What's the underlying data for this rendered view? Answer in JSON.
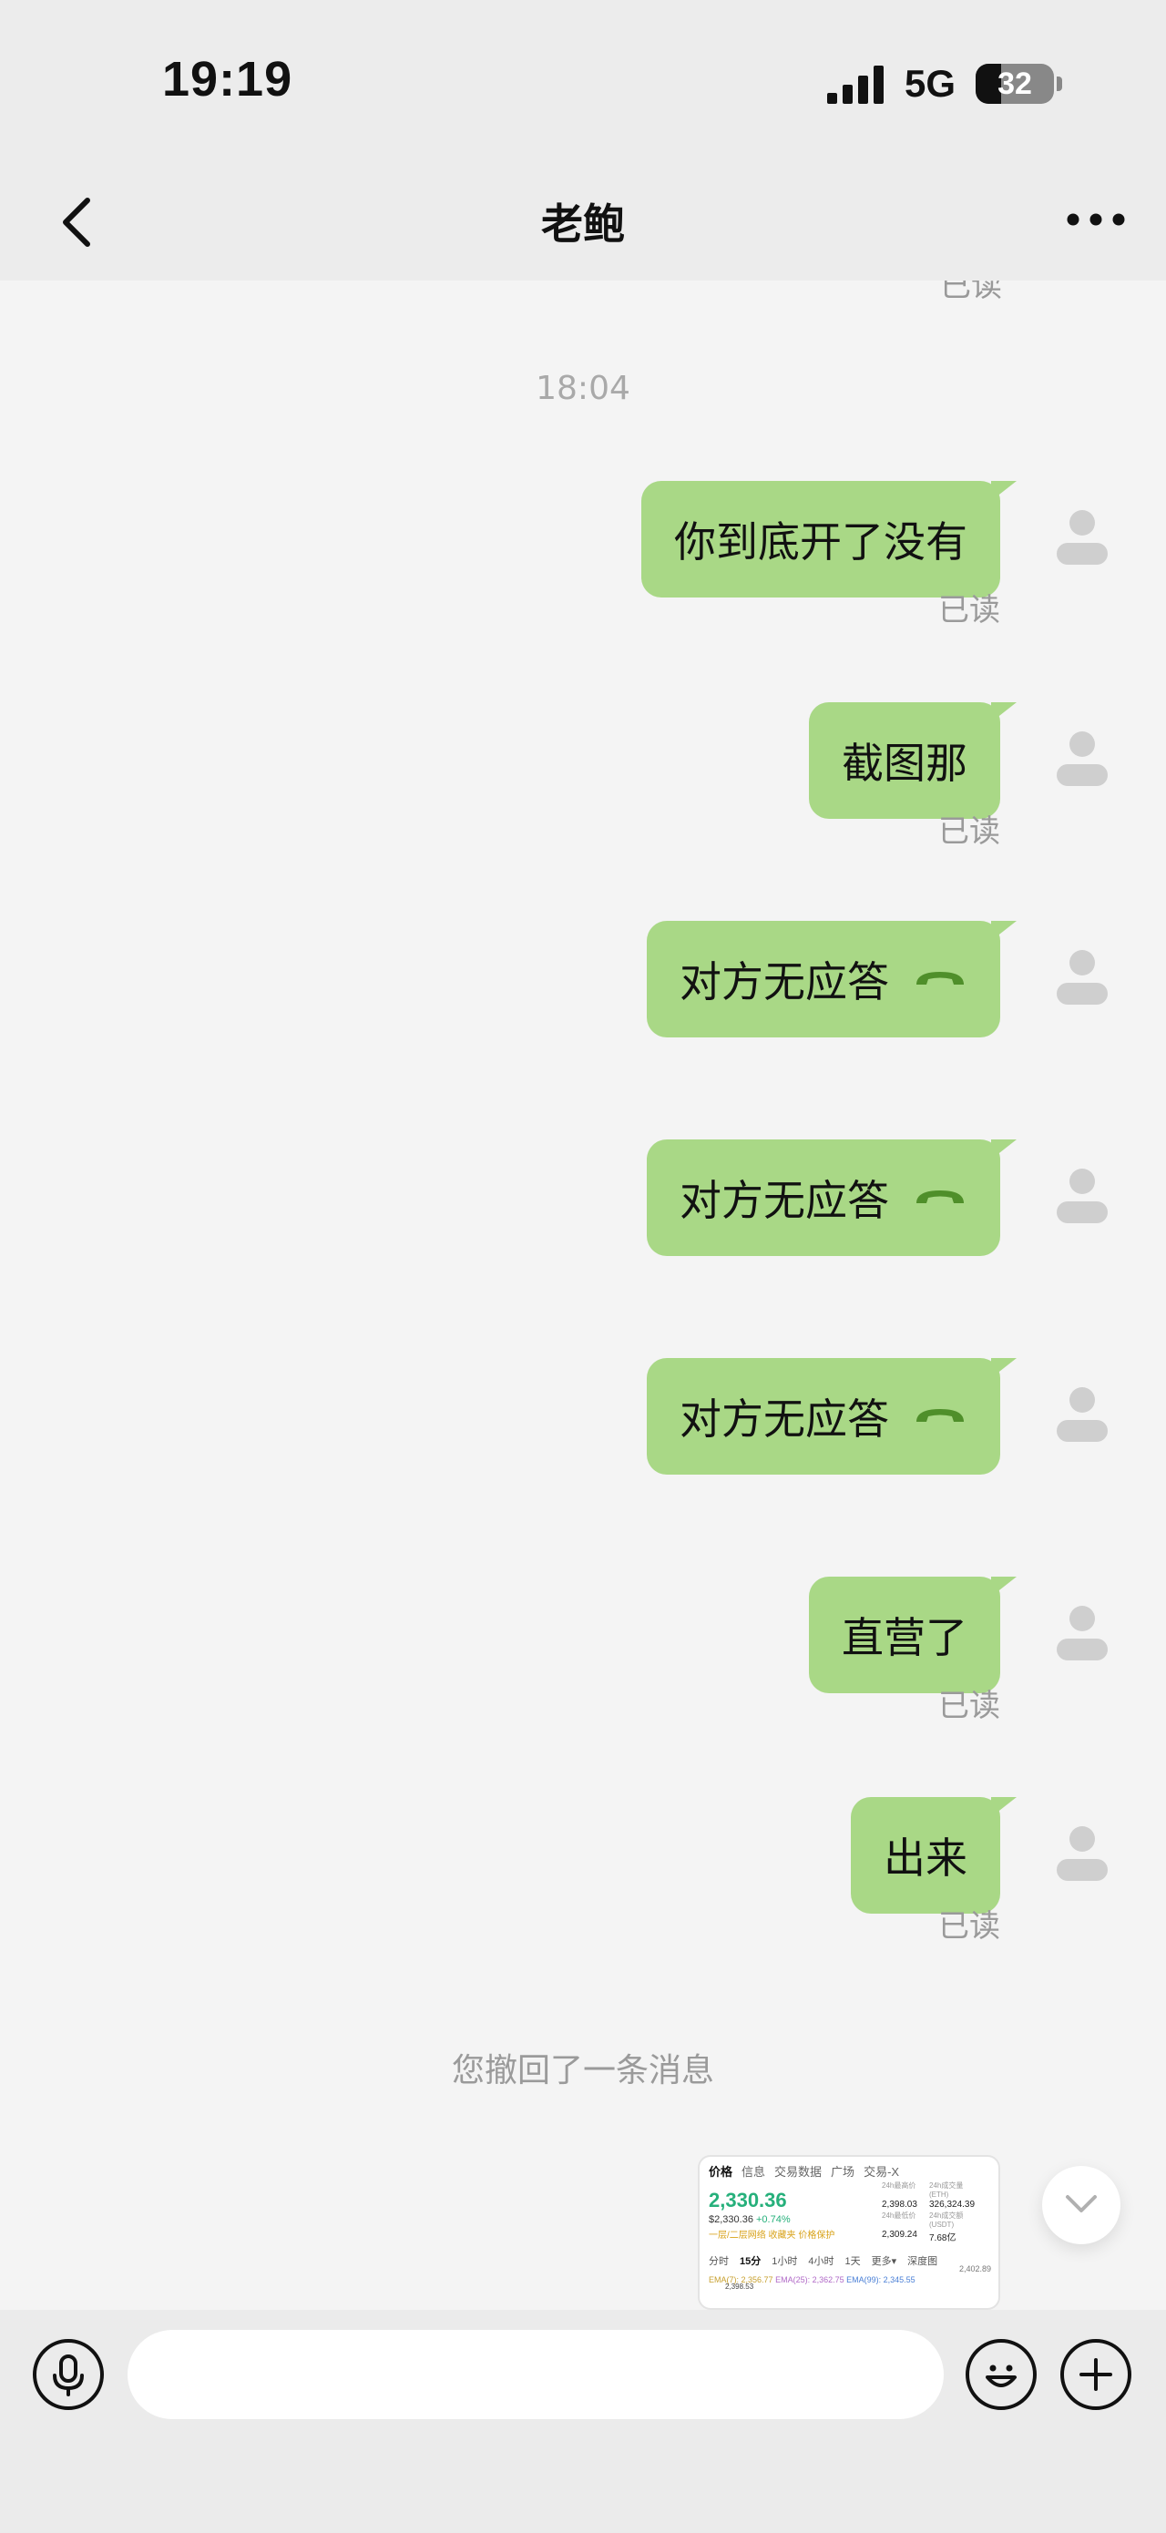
{
  "status_bar": {
    "time": "19:19",
    "network": "5G",
    "battery": "32",
    "battery_fraction": 0.32
  },
  "header": {
    "title": "老鲍",
    "back_icon": "chevron-left-icon",
    "more_icon": "ellipsis-icon"
  },
  "chat": {
    "partial_receipt": "已读",
    "timestamp": "18:04",
    "messages": [
      {
        "text": "你到底开了没有",
        "receipt": "已读"
      },
      {
        "text": "截图那",
        "receipt": "已读"
      },
      {
        "text": "对方无应答",
        "icon": "hangup-phone-icon"
      },
      {
        "text": "对方无应答",
        "icon": "hangup-phone-icon"
      },
      {
        "text": "对方无应答",
        "icon": "hangup-phone-icon"
      },
      {
        "text": "直营了",
        "receipt": "已读"
      },
      {
        "text": "出来",
        "receipt": "已读"
      }
    ],
    "recall_notice": "您撤回了一条消息",
    "image_message": {
      "tabs": [
        "价格",
        "信息",
        "交易数据",
        "广场",
        "交易-X"
      ],
      "price": "2,330.36",
      "sub_usd": "$2,330.36",
      "sub_change": "+0.74%",
      "tags": "一层/二层网络  收藏夹  价格保护",
      "stats": [
        {
          "label": "24h最高价",
          "value": "2,398.03"
        },
        {
          "label": "24h成交量(ETH)",
          "value": "326,324.39"
        },
        {
          "label": "24h最低价",
          "value": "2,309.24"
        },
        {
          "label": "24h成交额(USDT)",
          "value": "7.68亿"
        }
      ],
      "periods": [
        "分时",
        "15分",
        "1小时",
        "4小时",
        "1天",
        "更多▾",
        "深度图"
      ],
      "active_period": "15分",
      "ema": {
        "a": "EMA(7): 2,356.77",
        "b": "EMA(25): 2,362.75",
        "c": "EMA(99): 2,345.55"
      },
      "axis_label": "2,402.89",
      "mini_label": "2,398.53"
    }
  },
  "input_bar": {
    "placeholder": "",
    "voice_icon": "microphone-icon",
    "emoji_icon": "emoji-icon",
    "plus_icon": "plus-icon"
  },
  "colors": {
    "bubble": "#a9d886",
    "background": "#f4f4f4",
    "header": "#ececec",
    "price_up": "#26b07b"
  }
}
